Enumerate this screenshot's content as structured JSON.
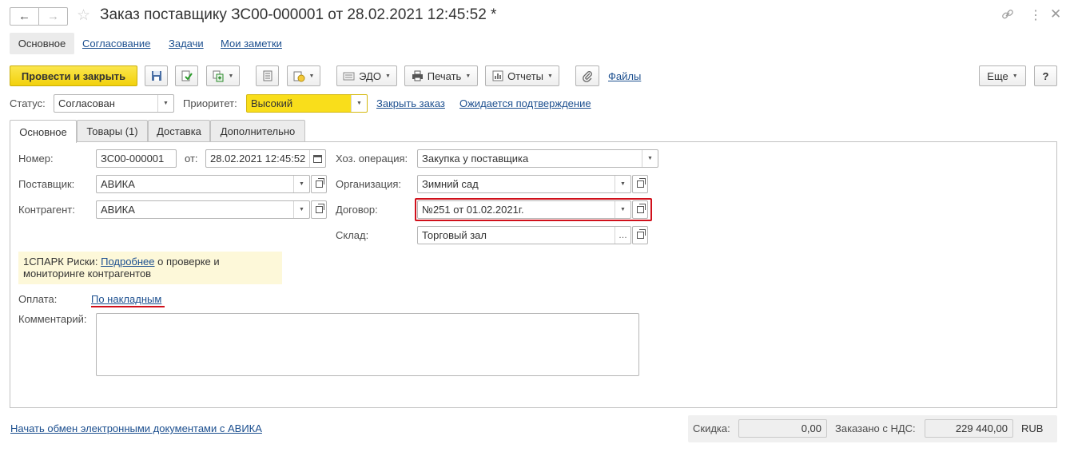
{
  "titlebar": {
    "title": "Заказ поставщику ЗС00-000001 от 28.02.2021 12:45:52 *",
    "back_icon": "arrow-left-icon",
    "forward_icon": "arrow-right-icon",
    "star_icon": "star-icon",
    "link_icon": "link-icon",
    "menu_icon": "kebab-menu-icon",
    "close_icon": "close-icon"
  },
  "sections": {
    "active": "Основное",
    "links": [
      "Согласование",
      "Задачи",
      "Мои заметки"
    ]
  },
  "toolbar": {
    "primary": "Провести и закрыть",
    "edo": "ЭДО",
    "print": "Печать",
    "reports": "Отчеты",
    "files": "Файлы",
    "more": "Еще",
    "help": "?"
  },
  "status_row": {
    "status_label": "Статус:",
    "status_value": "Согласован",
    "priority_label": "Приоритет:",
    "priority_value": "Высокий",
    "priority_color": "#f9de1b",
    "close_order_link": "Закрыть заказ",
    "awaiting_link": "Ожидается подтверждение"
  },
  "tabs": [
    "Основное",
    "Товары (1)",
    "Доставка",
    "Дополнительно"
  ],
  "form": {
    "number_label": "Номер:",
    "number_value": "ЗС00-000001",
    "from_label": "от:",
    "date_value": "28.02.2021 12:45:52",
    "supplier_label": "Поставщик:",
    "supplier_value": "АВИКА",
    "counterparty_label": "Контрагент:",
    "counterparty_value": "АВИКА",
    "operation_label": "Хоз. операция:",
    "operation_value": "Закупка у поставщика",
    "organization_label": "Организация:",
    "organization_value": "Зимний сад",
    "contract_label": "Договор:",
    "contract_value": "№251 от 01.02.2021г.",
    "warehouse_label": "Склад:",
    "warehouse_value": "Торговый зал",
    "spark_prefix": "1СПАРК Риски: ",
    "spark_link": "Подробнее",
    "spark_suffix": " о проверке и",
    "spark_line2": "мониторинге контрагентов",
    "payment_label": "Оплата:",
    "payment_link": "По накладным",
    "comment_label": "Комментарий:",
    "comment_value": ""
  },
  "footer": {
    "edo_link": "Начать обмен электронными документами с АВИКА",
    "discount_label": "Скидка:",
    "discount_value": "0,00",
    "ordered_label": "Заказано с НДС:",
    "ordered_value": "229 440,00",
    "currency": "RUB"
  },
  "accent_colors": {
    "highlight_red": "#d0101b",
    "link_blue": "#1c4f8f"
  }
}
